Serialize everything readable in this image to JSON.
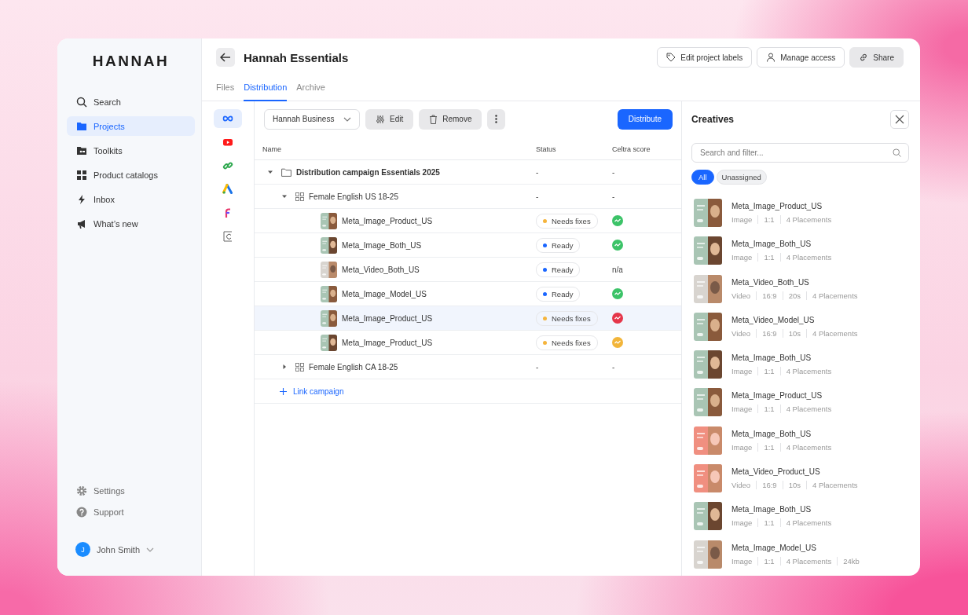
{
  "brand": "HANNAH",
  "sidebar": {
    "items": [
      {
        "label": "Search",
        "selected": false
      },
      {
        "label": "Projects",
        "selected": true
      },
      {
        "label": "Toolkits",
        "selected": false
      },
      {
        "label": "Product catalogs",
        "selected": false
      },
      {
        "label": "Inbox",
        "selected": false
      },
      {
        "label": "What’s new",
        "selected": false
      }
    ],
    "footer": [
      "Settings",
      "Support"
    ],
    "user": {
      "initial": "J",
      "name": "John Smith"
    }
  },
  "header": {
    "title": "Hannah Essentials",
    "buttons": [
      "Edit project labels",
      "Manage access",
      "Share"
    ]
  },
  "tabs": [
    {
      "label": "Files",
      "selected": false
    },
    {
      "label": "Distribution",
      "selected": true
    },
    {
      "label": "Archive",
      "selected": false
    }
  ],
  "channels": [
    {
      "selected": true
    },
    {
      "selected": false
    },
    {
      "selected": false
    },
    {
      "selected": false
    },
    {
      "selected": false
    },
    {
      "selected": false
    }
  ],
  "toolbar": {
    "account": "Hannah Business",
    "edit": "Edit",
    "remove": "Remove",
    "distribute": "Distribute"
  },
  "table": {
    "columns": [
      "Name",
      "Status",
      "Celtra score"
    ],
    "rows": [
      {
        "kind": "campaign",
        "name": "Distribution campaign Essentials 2025",
        "expanded": true,
        "status": "-",
        "score": "-",
        "children": [
          {
            "kind": "ad_set",
            "name": "Female English US 18-25",
            "expanded": true,
            "status": "-",
            "score": "-",
            "children": [
              {
                "kind": "creative",
                "name": "Meta_Image_Product_US",
                "selected": false,
                "status": {
                  "label": "Needs fixes",
                  "color": "#f5b43c"
                },
                "score": {
                  "color": "#3cc368"
                }
              },
              {
                "kind": "creative",
                "name": "Meta_Image_Both_US",
                "selected": false,
                "status": {
                  "label": "Ready",
                  "color": "#1a66ff"
                },
                "score": {
                  "color": "#3cc368"
                }
              },
              {
                "kind": "creative",
                "name": "Meta_Video_Both_US",
                "selected": false,
                "status": {
                  "label": "Ready",
                  "color": "#1a66ff"
                },
                "score": {
                  "label": "n/a"
                }
              },
              {
                "kind": "creative",
                "name": "Meta_Image_Model_US",
                "selected": false,
                "status": {
                  "label": "Ready",
                  "color": "#1a66ff"
                },
                "score": {
                  "color": "#3cc368"
                }
              },
              {
                "kind": "creative",
                "name": "Meta_Image_Product_US",
                "selected": true,
                "status": {
                  "label": "Needs fixes",
                  "color": "#f5b43c"
                },
                "score": {
                  "color": "#e5364a"
                }
              },
              {
                "kind": "creative",
                "name": "Meta_Image_Product_US",
                "selected": false,
                "status": {
                  "label": "Needs fixes",
                  "color": "#f5b43c"
                },
                "score": {
                  "color": "#f2b53a"
                }
              }
            ]
          },
          {
            "kind": "ad_set",
            "name": "Female English CA 18-25",
            "expanded": false,
            "status": "-",
            "score": "-"
          }
        ]
      }
    ],
    "link": "Link campaign"
  },
  "creatives": {
    "title": "Creatives",
    "placeholder": "Search and filter...",
    "filters": [
      {
        "label": "All",
        "selected": true
      },
      {
        "label": "Unassigned",
        "selected": false
      }
    ],
    "items": [
      {
        "name": "Meta_Image_Product_US",
        "meta": [
          "Image",
          "1:1",
          "4 Placements"
        ]
      },
      {
        "name": "Meta_Image_Both_US",
        "meta": [
          "Image",
          "1:1",
          "4 Placements"
        ]
      },
      {
        "name": "Meta_Video_Both_US",
        "meta": [
          "Video",
          "16:9",
          "20s",
          "4 Placements"
        ]
      },
      {
        "name": "Meta_Video_Model_US",
        "meta": [
          "Video",
          "16:9",
          "10s",
          "4 Placements"
        ]
      },
      {
        "name": "Meta_Image_Both_US",
        "meta": [
          "Image",
          "1:1",
          "4 Placements"
        ]
      },
      {
        "name": "Meta_Image_Product_US",
        "meta": [
          "Image",
          "1:1",
          "4 Placements"
        ]
      },
      {
        "name": "Meta_Image_Both_US",
        "meta": [
          "Image",
          "1:1",
          "4 Placements"
        ]
      },
      {
        "name": "Meta_Video_Product_US",
        "meta": [
          "Video",
          "16:9",
          "10s",
          "4 Placements"
        ]
      },
      {
        "name": "Meta_Image_Both_US",
        "meta": [
          "Image",
          "1:1",
          "4 Placements"
        ]
      },
      {
        "name": "Meta_Image_Model_US",
        "meta": [
          "Image",
          "1:1",
          "4 Placements",
          "24kb"
        ]
      }
    ]
  }
}
